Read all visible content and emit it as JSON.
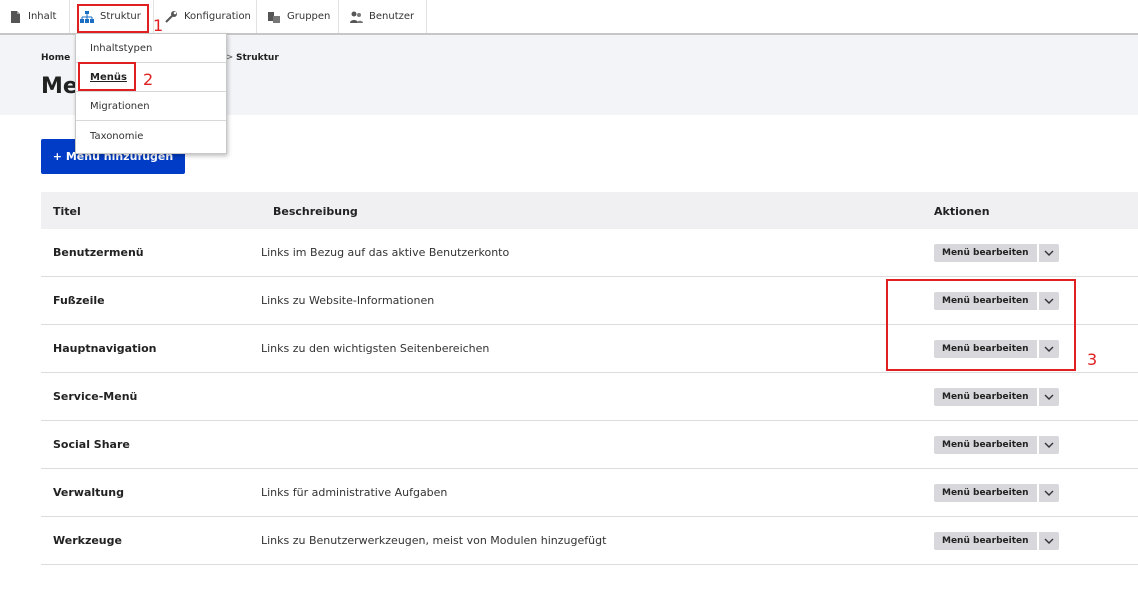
{
  "toolbar": {
    "items": [
      {
        "label": "Inhalt",
        "icon": "file-icon"
      },
      {
        "label": "Struktur",
        "icon": "sitemap-icon"
      },
      {
        "label": "Konfiguration",
        "icon": "wrench-icon"
      },
      {
        "label": "Gruppen",
        "icon": "group-icon"
      },
      {
        "label": "Benutzer",
        "icon": "user-icon"
      }
    ]
  },
  "dropdown": {
    "items": [
      {
        "label": "Inhaltstypen"
      },
      {
        "label": "Menüs"
      },
      {
        "label": "Migrationen"
      },
      {
        "label": "Taxonomie"
      }
    ]
  },
  "breadcrumb": {
    "home": "Home",
    "separator": ">",
    "current": "Struktur"
  },
  "page": {
    "title_visible": "Me"
  },
  "add_button": {
    "label": "+ Menü hinzufügen"
  },
  "table": {
    "headers": {
      "title": "Titel",
      "description": "Beschreibung",
      "actions": "Aktionen"
    },
    "rows": [
      {
        "title": "Benutzermenü",
        "description": "Links im Bezug auf das aktive Benutzerkonto",
        "action": "Menü bearbeiten"
      },
      {
        "title": "Fußzeile",
        "description": "Links zu Website-Informationen",
        "action": "Menü bearbeiten"
      },
      {
        "title": "Hauptnavigation",
        "description": "Links zu den wichtigsten Seitenbereichen",
        "action": "Menü bearbeiten"
      },
      {
        "title": "Service-Menü",
        "description": "",
        "action": "Menü bearbeiten"
      },
      {
        "title": "Social Share",
        "description": "",
        "action": "Menü bearbeiten"
      },
      {
        "title": "Verwaltung",
        "description": "Links für administrative Aufgaben",
        "action": "Menü bearbeiten"
      },
      {
        "title": "Werkzeuge",
        "description": "Links zu Benutzerwerkzeugen, meist von Modulen hinzugefügt",
        "action": "Menü bearbeiten"
      }
    ]
  },
  "annotations": {
    "n1": "1",
    "n2": "2",
    "n3": "3",
    "color": "#e02020"
  },
  "colors": {
    "primary": "#003cc5",
    "header_bg": "#f3f4f7"
  }
}
